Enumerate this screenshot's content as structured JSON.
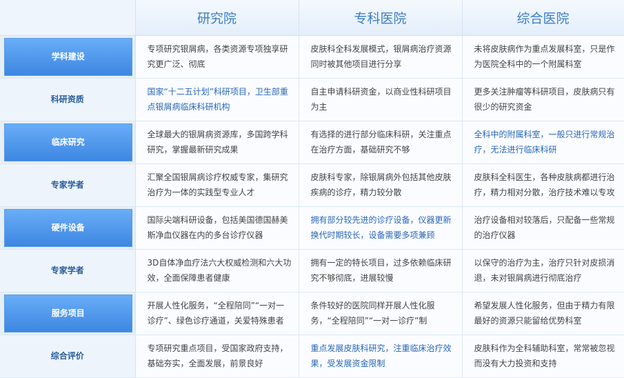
{
  "header": {
    "corner": "",
    "columns": [
      "研究院",
      "专科医院",
      "综合医院"
    ]
  },
  "rows": [
    {
      "label": "学科建设",
      "highlight": true,
      "cells": [
        "专项研究银屑病，各类资源专项独享研究更广泛、彻底",
        "皮肤科全科发展模式，银屑病治疗资源同时被其他项目进行分享",
        "未将皮肤病作为重点发展科室，只是作为医院全科中的一个附属科室"
      ],
      "blue": [
        false,
        false,
        false
      ]
    },
    {
      "label": "科研资质",
      "highlight": false,
      "cells": [
        "国家“十二五计划”科研项目，卫生部重点银屑病临床科研机构",
        "自主申请科研资金，以商业性科研项目为主",
        "更多关注肿瘤等科研项目，皮肤病只有很少的研究资金"
      ],
      "blue": [
        true,
        false,
        false
      ]
    },
    {
      "label": "临床研究",
      "highlight": true,
      "cells": [
        "全球最大的银屑病资源库，多国跨学科研究，掌握最新研究成果",
        "有选择的进行部分临床科研，关注重点在治疗方面，基础研究不够",
        "全科中的附属科室，一般只进行常规治疗，无法进行临床科研"
      ],
      "blue": [
        false,
        false,
        true
      ]
    },
    {
      "label": "专家学者",
      "highlight": false,
      "cells": [
        "汇聚全国银屑病诊疗权威专家，集研究治疗为一体的实践型专业人才",
        "皮肤科专家，除银屑病外包括其他皮肤疾病的诊疗，精力较分散",
        "皮肤科全科医生，各种皮肤病都进行治疗，精力相对分散，治疗技术难以专攻"
      ],
      "blue": [
        false,
        false,
        false
      ]
    },
    {
      "label": "硬件设备",
      "highlight": true,
      "cells": [
        "国际尖端科研设备，包括美国德国赫美斯净血仪器在内的多台诊疗仪器",
        "拥有部分较先进的诊疗设备，仪器更新换代时期较长，设备需要多项兼顾",
        "治疗设备相对较落后，只配备一些常规的治疗仪器"
      ],
      "blue": [
        false,
        true,
        false
      ]
    },
    {
      "label": "专家学者",
      "highlight": false,
      "cells": [
        "3D自体净血疗法六大权威检测和六大功效，全面保障患者健康",
        "拥有一定的特长项目，过多依赖临床研究不够彻底，进展较慢",
        "以保守的治疗为主，治疗只针对皮损消退，未对银屑病进行彻底治疗"
      ],
      "blue": [
        false,
        false,
        false
      ]
    },
    {
      "label": "服务项目",
      "highlight": true,
      "cells": [
        "开展人性化服务，“全程陪同”“一对一诊疗”、绿色诊疗通道，关爱特殊患者",
        "条件较好的医院同样开展人性化服务，“全程陪同”“一对一诊疗”制",
        "希望发展人性化服务，但由于精力有限最好的资源只能留给优势科室"
      ],
      "blue": [
        false,
        false,
        false
      ]
    },
    {
      "label": "综合评价",
      "highlight": false,
      "cells": [
        "专项研究重点项目，受国家政府支持，基础夯实，全面发展，前景良好",
        "重点发展皮肤科研究，注重临床治疗效果，受发展资金限制",
        "皮肤科作为全科辅助科室，常常被忽视而没有大力投资和支持"
      ],
      "blue": [
        false,
        true,
        false
      ]
    }
  ]
}
